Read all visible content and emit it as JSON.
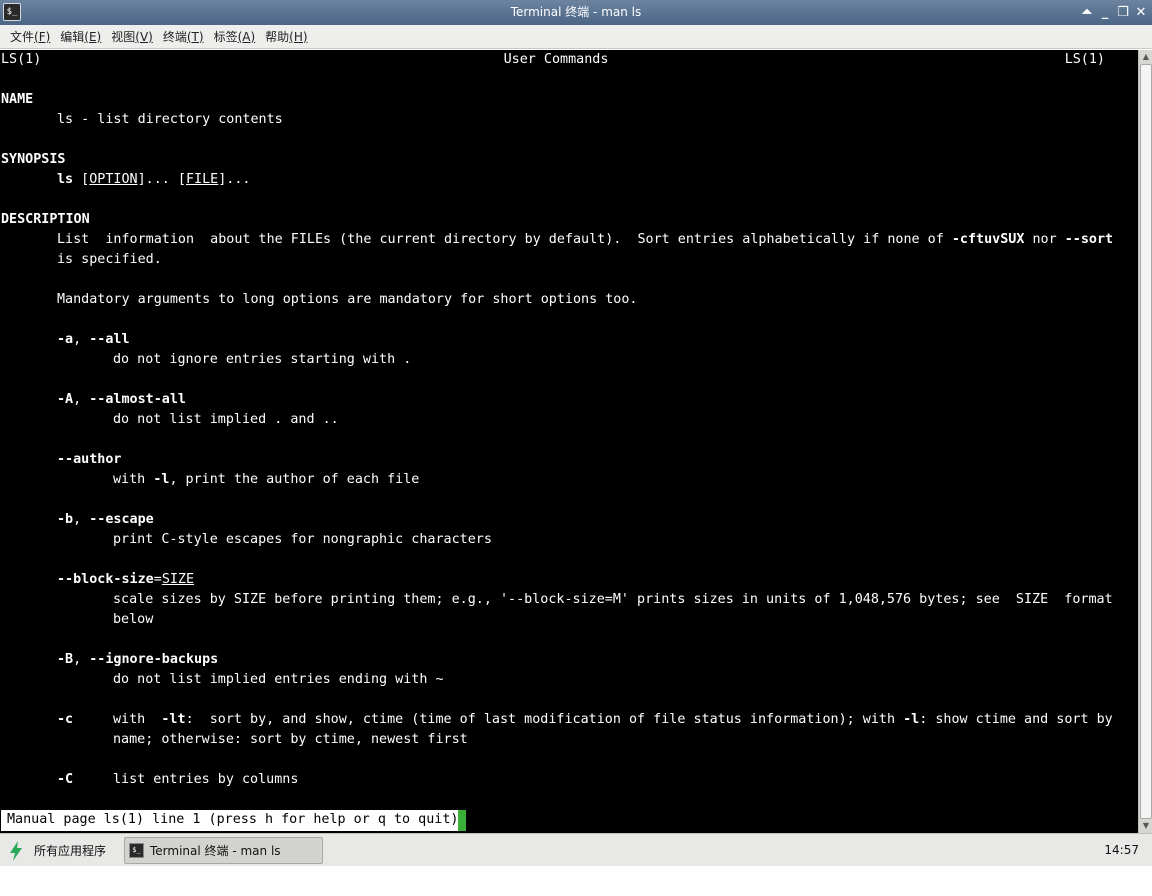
{
  "window": {
    "title": "Terminal 终端 - man ls",
    "icon": "terminal-icon",
    "buttons": {
      "shade": "⏶",
      "minimize": "_",
      "maximize": "❐",
      "close": "✕"
    }
  },
  "menubar": {
    "items": [
      {
        "label": "文件",
        "accel": "(F)"
      },
      {
        "label": "编辑",
        "accel": "(E)"
      },
      {
        "label": "视图",
        "accel": "(V)"
      },
      {
        "label": "终端",
        "accel": "(T)"
      },
      {
        "label": "标签",
        "accel": "(A)"
      },
      {
        "label": "帮助",
        "accel": "(H)"
      }
    ]
  },
  "man": {
    "header_left": "LS(1)",
    "header_center": "User Commands",
    "header_right": "LS(1)",
    "name_heading": "NAME",
    "name_text": "ls - list directory contents",
    "synopsis_heading": "SYNOPSIS",
    "synopsis_cmd": "ls",
    "synopsis_option": "OPTION",
    "synopsis_file": "FILE",
    "description_heading": "DESCRIPTION",
    "desc_line1_a": "List  information  about the FILEs (the current directory by default).  Sort entries alphabetically if none of ",
    "desc_line1_flag1": "-cftuvSUX",
    "desc_line1_b": " nor ",
    "desc_line1_flag2": "--sort",
    "desc_line2": "is specified.",
    "mandatory": "Mandatory arguments to long options are mandatory for short options too.",
    "opt_a_short": "-a",
    "opt_a_long": "--all",
    "opt_a_desc": "do not ignore entries starting with .",
    "opt_A_short": "-A",
    "opt_A_long": "--almost-all",
    "opt_A_desc": "do not list implied . and ..",
    "opt_author": "--author",
    "opt_author_desc_a": "with ",
    "opt_author_desc_flag": "-l",
    "opt_author_desc_b": ", print the author of each file",
    "opt_b_short": "-b",
    "opt_b_long": "--escape",
    "opt_b_desc": "print C-style escapes for nongraphic characters",
    "opt_bs_long": "--block-size",
    "opt_bs_arg": "SIZE",
    "opt_bs_desc1": "scale sizes by SIZE before printing them; e.g., '--block-size=M' prints sizes in units of 1,048,576 bytes; see  SIZE  format",
    "opt_bs_desc2": "below",
    "opt_B_short": "-B",
    "opt_B_long": "--ignore-backups",
    "opt_B_desc": "do not list implied entries ending with ~",
    "opt_c_short": "-c",
    "opt_c_desc1_a": "with  ",
    "opt_c_desc1_flag1": "-lt",
    "opt_c_desc1_b": ":  sort by, and show, ctime (time of last modification of file status information); with ",
    "opt_c_desc1_flag2": "-l",
    "opt_c_desc1_c": ": show ctime and sort by",
    "opt_c_desc2": "name; otherwise: sort by ctime, newest first",
    "opt_C_short": "-C",
    "opt_C_desc": "list entries by columns"
  },
  "status_line": "Manual page ls(1) line 1 (press h for help or q to quit)",
  "taskbar": {
    "start_label": "所有应用程序",
    "task_label": "Terminal 终端 - man ls",
    "clock": "14:57"
  },
  "colors": {
    "terminal_bg": "#000000",
    "terminal_fg": "#ffffff",
    "cursor": "#3ab03a",
    "titlebar": "#5a7393",
    "taskbar_bg": "#e8e8e6"
  }
}
